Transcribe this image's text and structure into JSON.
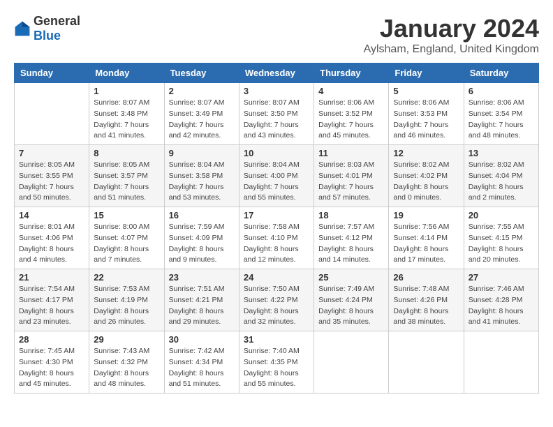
{
  "header": {
    "logo_general": "General",
    "logo_blue": "Blue",
    "title": "January 2024",
    "subtitle": "Aylsham, England, United Kingdom"
  },
  "calendar": {
    "days_of_week": [
      "Sunday",
      "Monday",
      "Tuesday",
      "Wednesday",
      "Thursday",
      "Friday",
      "Saturday"
    ],
    "weeks": [
      [
        {
          "day": "",
          "info": ""
        },
        {
          "day": "1",
          "info": "Sunrise: 8:07 AM\nSunset: 3:48 PM\nDaylight: 7 hours\nand 41 minutes."
        },
        {
          "day": "2",
          "info": "Sunrise: 8:07 AM\nSunset: 3:49 PM\nDaylight: 7 hours\nand 42 minutes."
        },
        {
          "day": "3",
          "info": "Sunrise: 8:07 AM\nSunset: 3:50 PM\nDaylight: 7 hours\nand 43 minutes."
        },
        {
          "day": "4",
          "info": "Sunrise: 8:06 AM\nSunset: 3:52 PM\nDaylight: 7 hours\nand 45 minutes."
        },
        {
          "day": "5",
          "info": "Sunrise: 8:06 AM\nSunset: 3:53 PM\nDaylight: 7 hours\nand 46 minutes."
        },
        {
          "day": "6",
          "info": "Sunrise: 8:06 AM\nSunset: 3:54 PM\nDaylight: 7 hours\nand 48 minutes."
        }
      ],
      [
        {
          "day": "7",
          "info": "Sunrise: 8:05 AM\nSunset: 3:55 PM\nDaylight: 7 hours\nand 50 minutes."
        },
        {
          "day": "8",
          "info": "Sunrise: 8:05 AM\nSunset: 3:57 PM\nDaylight: 7 hours\nand 51 minutes."
        },
        {
          "day": "9",
          "info": "Sunrise: 8:04 AM\nSunset: 3:58 PM\nDaylight: 7 hours\nand 53 minutes."
        },
        {
          "day": "10",
          "info": "Sunrise: 8:04 AM\nSunset: 4:00 PM\nDaylight: 7 hours\nand 55 minutes."
        },
        {
          "day": "11",
          "info": "Sunrise: 8:03 AM\nSunset: 4:01 PM\nDaylight: 7 hours\nand 57 minutes."
        },
        {
          "day": "12",
          "info": "Sunrise: 8:02 AM\nSunset: 4:02 PM\nDaylight: 8 hours\nand 0 minutes."
        },
        {
          "day": "13",
          "info": "Sunrise: 8:02 AM\nSunset: 4:04 PM\nDaylight: 8 hours\nand 2 minutes."
        }
      ],
      [
        {
          "day": "14",
          "info": "Sunrise: 8:01 AM\nSunset: 4:06 PM\nDaylight: 8 hours\nand 4 minutes."
        },
        {
          "day": "15",
          "info": "Sunrise: 8:00 AM\nSunset: 4:07 PM\nDaylight: 8 hours\nand 7 minutes."
        },
        {
          "day": "16",
          "info": "Sunrise: 7:59 AM\nSunset: 4:09 PM\nDaylight: 8 hours\nand 9 minutes."
        },
        {
          "day": "17",
          "info": "Sunrise: 7:58 AM\nSunset: 4:10 PM\nDaylight: 8 hours\nand 12 minutes."
        },
        {
          "day": "18",
          "info": "Sunrise: 7:57 AM\nSunset: 4:12 PM\nDaylight: 8 hours\nand 14 minutes."
        },
        {
          "day": "19",
          "info": "Sunrise: 7:56 AM\nSunset: 4:14 PM\nDaylight: 8 hours\nand 17 minutes."
        },
        {
          "day": "20",
          "info": "Sunrise: 7:55 AM\nSunset: 4:15 PM\nDaylight: 8 hours\nand 20 minutes."
        }
      ],
      [
        {
          "day": "21",
          "info": "Sunrise: 7:54 AM\nSunset: 4:17 PM\nDaylight: 8 hours\nand 23 minutes."
        },
        {
          "day": "22",
          "info": "Sunrise: 7:53 AM\nSunset: 4:19 PM\nDaylight: 8 hours\nand 26 minutes."
        },
        {
          "day": "23",
          "info": "Sunrise: 7:51 AM\nSunset: 4:21 PM\nDaylight: 8 hours\nand 29 minutes."
        },
        {
          "day": "24",
          "info": "Sunrise: 7:50 AM\nSunset: 4:22 PM\nDaylight: 8 hours\nand 32 minutes."
        },
        {
          "day": "25",
          "info": "Sunrise: 7:49 AM\nSunset: 4:24 PM\nDaylight: 8 hours\nand 35 minutes."
        },
        {
          "day": "26",
          "info": "Sunrise: 7:48 AM\nSunset: 4:26 PM\nDaylight: 8 hours\nand 38 minutes."
        },
        {
          "day": "27",
          "info": "Sunrise: 7:46 AM\nSunset: 4:28 PM\nDaylight: 8 hours\nand 41 minutes."
        }
      ],
      [
        {
          "day": "28",
          "info": "Sunrise: 7:45 AM\nSunset: 4:30 PM\nDaylight: 8 hours\nand 45 minutes."
        },
        {
          "day": "29",
          "info": "Sunrise: 7:43 AM\nSunset: 4:32 PM\nDaylight: 8 hours\nand 48 minutes."
        },
        {
          "day": "30",
          "info": "Sunrise: 7:42 AM\nSunset: 4:34 PM\nDaylight: 8 hours\nand 51 minutes."
        },
        {
          "day": "31",
          "info": "Sunrise: 7:40 AM\nSunset: 4:35 PM\nDaylight: 8 hours\nand 55 minutes."
        },
        {
          "day": "",
          "info": ""
        },
        {
          "day": "",
          "info": ""
        },
        {
          "day": "",
          "info": ""
        }
      ]
    ]
  }
}
